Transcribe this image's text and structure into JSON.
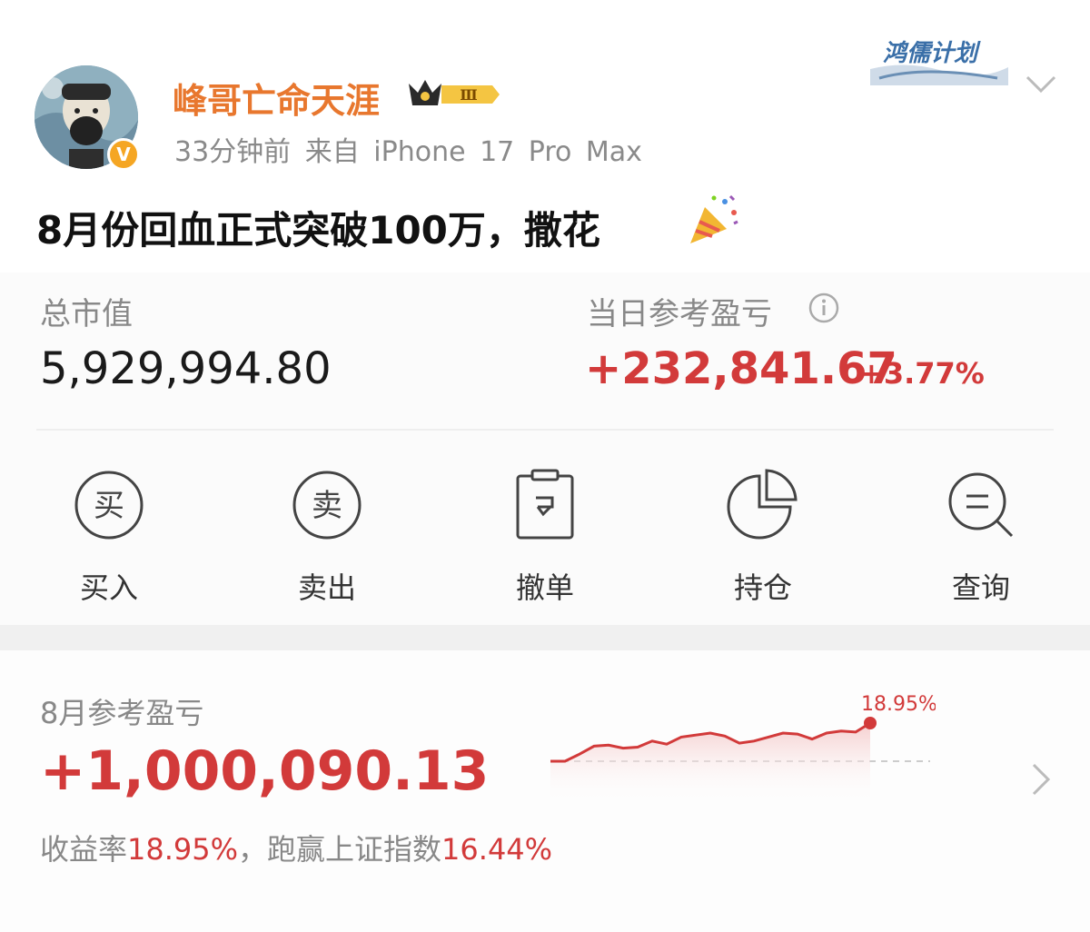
{
  "user": {
    "name": "峰哥亡命天涯",
    "level_badge": "Ⅲ",
    "time": "33分钟前",
    "source": "来自 iPhone 17 Pro Max",
    "program_badge": "鸿儒计划",
    "verified_mark": "V"
  },
  "post": {
    "text": "8月份回血正式突破100万，撒花"
  },
  "portfolio": {
    "total_label": "总市值",
    "total_value": "5,929,994.80",
    "daily_label": "当日参考盈亏",
    "daily_value": "+232,841.67",
    "daily_pct": "+3.77%"
  },
  "actions": [
    {
      "label": "买入",
      "icon_char": "买",
      "icon": "buy-icon"
    },
    {
      "label": "卖出",
      "icon_char": "卖",
      "icon": "sell-icon"
    },
    {
      "label": "撤单",
      "icon": "cancel-order-icon"
    },
    {
      "label": "持仓",
      "icon": "pie-chart-icon"
    },
    {
      "label": "查询",
      "icon": "search-icon"
    }
  ],
  "monthly": {
    "label": "8月参考盈亏",
    "value": "+1,000,090.13",
    "return_label": "收益率",
    "return_value": "18.95%",
    "beat_label": "，跑赢上证指数",
    "beat_value": "16.44%"
  },
  "chart_data": {
    "type": "area",
    "series": [
      {
        "values": [
          0,
          0,
          3.5,
          7.5,
          8,
          6.5,
          7,
          10,
          8.5,
          12,
          13,
          14,
          12.5,
          9,
          10,
          12,
          14,
          13.5,
          11,
          14,
          15,
          14.5,
          18.95
        ]
      }
    ],
    "end_label": "18.95%",
    "baseline": 0,
    "colors": {
      "line": "#d23a3a",
      "fill": "#f7d3d3",
      "baseline": "#cccccc"
    }
  },
  "colors": {
    "accent": "#d23a3a",
    "username": "#e8772e",
    "muted": "#888888"
  }
}
